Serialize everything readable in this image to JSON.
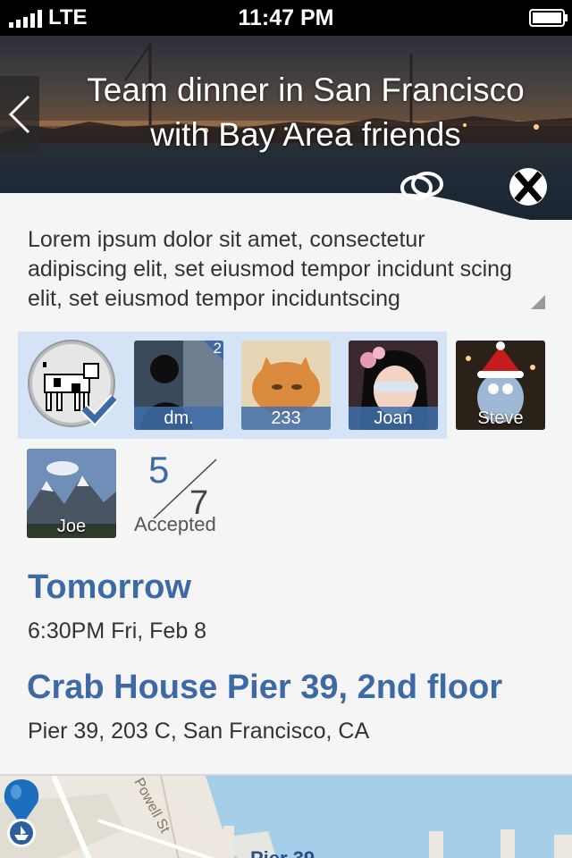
{
  "status_bar": {
    "carrier": "LTE",
    "time": "11:47 PM"
  },
  "header": {
    "title_line1": "Team dinner in San Francisco",
    "title_line2": "with Bay Area friends"
  },
  "description": "Lorem ipsum dolor sit amet, consectetur adipiscing elit, set eiusmod tempor incidunt scing elit, set eiusmod tempor inciduntscing",
  "attendees": [
    {
      "name": "dm.",
      "badge": "2"
    },
    {
      "name": "233"
    },
    {
      "name": "Joan"
    },
    {
      "name": "Steve"
    },
    {
      "name": "Joe"
    }
  ],
  "rsvp": {
    "accepted": "5",
    "total": "7",
    "label": "Accepted"
  },
  "when": {
    "title": "Tomorrow",
    "detail": "6:30PM Fri, Feb 8"
  },
  "place": {
    "title": "Crab House Pier 39, 2nd floor",
    "address": "Pier 39, 203 C, San Francisco, CA"
  },
  "map": {
    "street_label": "Powell St",
    "pin_label": "Pier 39"
  },
  "colors": {
    "accent": "#3d6aa6",
    "highlight": "#d4e4f6",
    "map_water": "#a5cfe8"
  }
}
